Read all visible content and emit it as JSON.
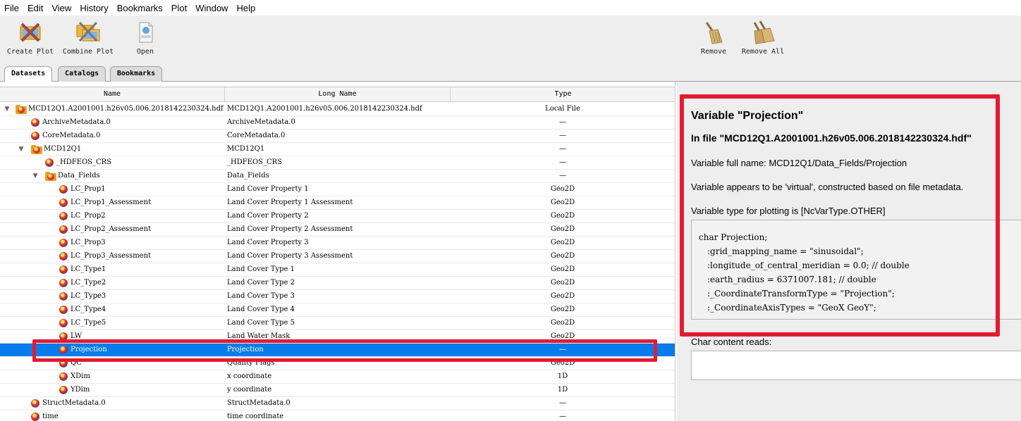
{
  "menu": [
    "File",
    "Edit",
    "View",
    "History",
    "Bookmarks",
    "Plot",
    "Window",
    "Help"
  ],
  "toolbar": {
    "create_plot": "Create Plot",
    "combine_plot": "Combine Plot",
    "open": "Open",
    "remove": "Remove",
    "remove_all": "Remove All"
  },
  "tabs": [
    "Datasets",
    "Catalogs",
    "Bookmarks"
  ],
  "table": {
    "columns": [
      "Name",
      "Long Name",
      "Type"
    ],
    "rows": [
      {
        "name": "MCD12Q1.A2001001.h26v05.006.2018142230324.hdf",
        "long": "MCD12Q1.A2001001.h26v05.006.2018142230324.hdf",
        "type": "Local File",
        "level": 0,
        "kind": "file",
        "toggle": "▼"
      },
      {
        "name": "ArchiveMetadata.0",
        "long": "ArchiveMetadata.0",
        "type": "—",
        "level": 1,
        "kind": "var"
      },
      {
        "name": "CoreMetadata.0",
        "long": "CoreMetadata.0",
        "type": "—",
        "level": 1,
        "kind": "var"
      },
      {
        "name": "MCD12Q1",
        "long": "MCD12Q1",
        "type": "—",
        "level": 1,
        "kind": "folder",
        "toggle": "▼"
      },
      {
        "name": "_HDFEOS_CRS",
        "long": "_HDFEOS_CRS",
        "type": "—",
        "level": 2,
        "kind": "var"
      },
      {
        "name": "Data_Fields",
        "long": "Data_Fields",
        "type": "—",
        "level": 2,
        "kind": "folder",
        "toggle": "▼"
      },
      {
        "name": "LC_Prop1",
        "long": "Land Cover Property 1",
        "type": "Geo2D",
        "level": 3,
        "kind": "var"
      },
      {
        "name": "LC_Prop1_Assessment",
        "long": "Land Cover Property 1 Assessment",
        "type": "Geo2D",
        "level": 3,
        "kind": "var"
      },
      {
        "name": "LC_Prop2",
        "long": "Land Cover Property 2",
        "type": "Geo2D",
        "level": 3,
        "kind": "var"
      },
      {
        "name": "LC_Prop2_Assessment",
        "long": "Land Cover Property 2 Assessment",
        "type": "Geo2D",
        "level": 3,
        "kind": "var"
      },
      {
        "name": "LC_Prop3",
        "long": "Land Cover Property 3",
        "type": "Geo2D",
        "level": 3,
        "kind": "var"
      },
      {
        "name": "LC_Prop3_Assessment",
        "long": "Land Cover Property 3 Assessment",
        "type": "Geo2D",
        "level": 3,
        "kind": "var"
      },
      {
        "name": "LC_Type1",
        "long": "Land Cover Type 1",
        "type": "Geo2D",
        "level": 3,
        "kind": "var"
      },
      {
        "name": "LC_Type2",
        "long": "Land Cover Type 2",
        "type": "Geo2D",
        "level": 3,
        "kind": "var"
      },
      {
        "name": "LC_Type3",
        "long": "Land Cover Type 3",
        "type": "Geo2D",
        "level": 3,
        "kind": "var"
      },
      {
        "name": "LC_Type4",
        "long": "Land Cover Type 4",
        "type": "Geo2D",
        "level": 3,
        "kind": "var"
      },
      {
        "name": "LC_Type5",
        "long": "Land Cover Type 5",
        "type": "Geo2D",
        "level": 3,
        "kind": "var"
      },
      {
        "name": "LW",
        "long": "Land Water Mask",
        "type": "Geo2D",
        "level": 3,
        "kind": "var"
      },
      {
        "name": "Projection",
        "long": "Projection",
        "type": "—",
        "level": 3,
        "kind": "var",
        "selected": true
      },
      {
        "name": "QC",
        "long": "Quality Flags",
        "type": "Geo2D",
        "level": 3,
        "kind": "var"
      },
      {
        "name": "XDim",
        "long": "x coordinate",
        "type": "1D",
        "level": 3,
        "kind": "var"
      },
      {
        "name": "YDim",
        "long": "y coordinate",
        "type": "1D",
        "level": 3,
        "kind": "var"
      },
      {
        "name": "StructMetadata.0",
        "long": "StructMetadata.0",
        "type": "—",
        "level": 1,
        "kind": "var"
      },
      {
        "name": "time",
        "long": "time coordinate",
        "type": "—",
        "level": 1,
        "kind": "var"
      }
    ]
  },
  "info": {
    "title": "Variable \"Projection\"",
    "file": "In file \"MCD12Q1.A2001001.h26v05.006.2018142230324.hdf\"",
    "full_name": "Variable full name: MCD12Q1/Data_Fields/Projection",
    "virtual_note": "Variable appears to be 'virtual', constructed based on file metadata.",
    "plot_type": "Variable type for plotting is [NcVarType.OTHER]",
    "code": [
      "char Projection;",
      ":grid_mapping_name = \"sinusoidal\";",
      ":longitude_of_central_meridian = 0.0; // double",
      ":earth_radius = 6371007.181; // double",
      ":_CoordinateTransformType = \"Projection\";",
      ":_CoordinateAxisTypes = \"GeoX GeoY\";"
    ],
    "char_content_label": "Char content reads:",
    "char_content_value": ""
  },
  "colors": {
    "selection": "#0a7bea",
    "highlight": "#e21b33"
  }
}
